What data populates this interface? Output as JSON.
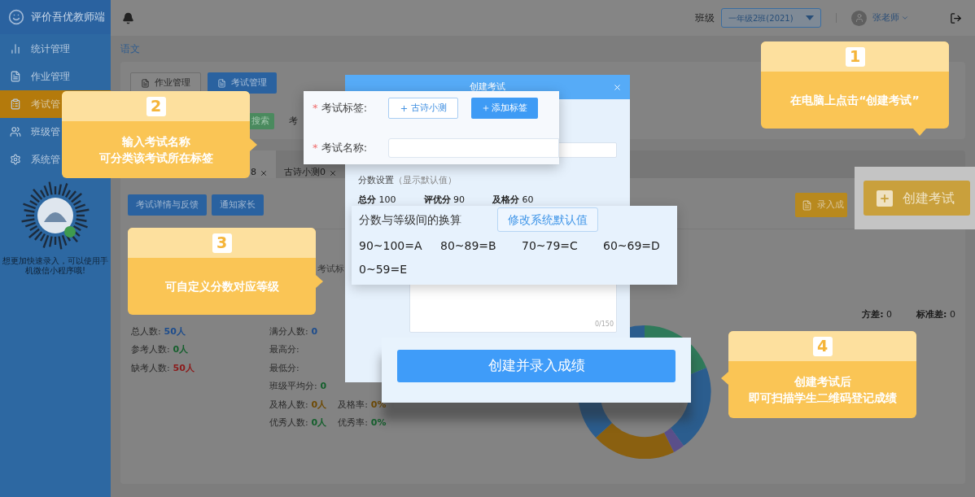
{
  "sidebar": {
    "app_title": "评价吾优教师端",
    "items": [
      {
        "label": "统计管理",
        "selected": false
      },
      {
        "label": "作业管理",
        "selected": false
      },
      {
        "label": "考试管",
        "selected": true
      },
      {
        "label": "班级管",
        "selected": false
      },
      {
        "label": "系统管",
        "selected": false
      }
    ],
    "qr_caption": "想更加快速录入，可以使用手机微信小程序哦!"
  },
  "header": {
    "class_label": "班级",
    "class_value": "一年级2班(2021)",
    "user": "张老师"
  },
  "breadcrumb": "语文",
  "module_tabs": [
    {
      "label": "作业管理",
      "selected": false
    },
    {
      "label": "考试管理",
      "selected": true
    }
  ],
  "search_button": "搜索",
  "filter_label": "考",
  "exam_tabs": [
    {
      "label": "8",
      "selected": true
    },
    {
      "label": "古诗小测0",
      "selected": false
    }
  ],
  "action_buttons": [
    "考试详情与反馈",
    "通知家长"
  ],
  "record_button": "录入成",
  "background_label": "考试标",
  "variance": [
    {
      "label": "方差:",
      "value": "0"
    },
    {
      "label": "标准差:",
      "value": "0"
    }
  ],
  "stats_left": [
    {
      "label": "总人数:",
      "value": "50人",
      "color": "#1d4c8c"
    },
    {
      "label": "参考人数:",
      "value": "0人",
      "color": "#145f2c"
    },
    {
      "label": "缺考人数:",
      "value": "50人",
      "color": "#8c1a1a"
    }
  ],
  "stats_right": [
    [
      {
        "label": "满分人数:",
        "value": "0",
        "color": "#1d4c8c"
      }
    ],
    [
      {
        "label": "最高分:"
      }
    ],
    [
      {
        "label": "最低分:"
      }
    ],
    [
      {
        "label": "班级平均分:",
        "value": "0",
        "color": "#145f2c"
      }
    ],
    [
      {
        "label": "及格人数:",
        "value": "0人",
        "color": "#6e4a05"
      },
      {
        "label": "及格率:",
        "value": "0%",
        "color": "#6e4a05"
      }
    ],
    [
      {
        "label": "优秀人数:",
        "value": "0人",
        "color": "#145f2c"
      },
      {
        "label": "优秀率:",
        "value": "0%",
        "color": "#145f2c"
      }
    ]
  ],
  "dialog": {
    "title": "创建考试",
    "score_heading": "分数设置",
    "score_hint": "（显示默认值）",
    "scores": [
      {
        "label": "总分",
        "value": "100"
      },
      {
        "label": "评优分",
        "value": "90"
      },
      {
        "label": "及格分",
        "value": "60"
      }
    ],
    "remark_counter": "0/150"
  },
  "tag_popup": {
    "fields": [
      {
        "mark": "*",
        "label": "考试标签:"
      },
      {
        "mark": "*",
        "label": "考试名称:"
      }
    ],
    "tags": [
      "古诗小测"
    ],
    "add_tag": "添加标签"
  },
  "grade_popup": {
    "title": "分数与等级间的换算",
    "edit_button": "修改系统默认值",
    "grades": [
      "90~100=A",
      "80~89=B",
      "70~79=C",
      "60~69=D",
      "0~59=E"
    ]
  },
  "submit_popup": {
    "button": "创建并录入成绩"
  },
  "create_panel": {
    "button": "创建考试"
  },
  "callouts": [
    {
      "number": "1",
      "lines": [
        "在电脑上点击“创建考试”"
      ],
      "kind": "down"
    },
    {
      "number": "2",
      "lines": [
        "输入考试名称",
        "可分类该考试所在标签"
      ],
      "kind": "right"
    },
    {
      "number": "3",
      "lines": [
        "可自定义分数对应等级"
      ],
      "kind": "right"
    },
    {
      "number": "4",
      "lines": [
        "创建考试后",
        "即可扫描学生二维码登记成绩"
      ],
      "kind": "left"
    }
  ]
}
